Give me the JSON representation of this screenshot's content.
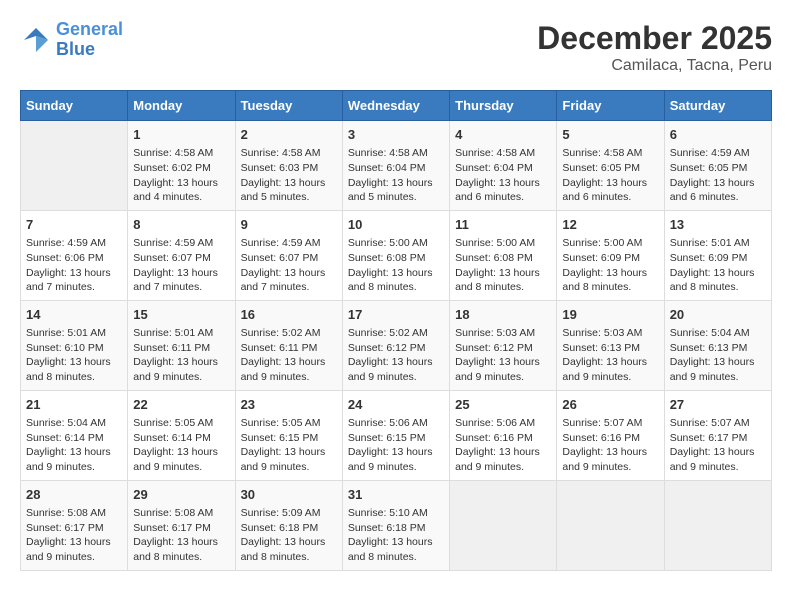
{
  "logo": {
    "line1": "General",
    "line2": "Blue"
  },
  "title": "December 2025",
  "subtitle": "Camilaca, Tacna, Peru",
  "days_header": [
    "Sunday",
    "Monday",
    "Tuesday",
    "Wednesday",
    "Thursday",
    "Friday",
    "Saturday"
  ],
  "weeks": [
    [
      {
        "day": "",
        "info": ""
      },
      {
        "day": "1",
        "info": "Sunrise: 4:58 AM\nSunset: 6:02 PM\nDaylight: 13 hours\nand 4 minutes."
      },
      {
        "day": "2",
        "info": "Sunrise: 4:58 AM\nSunset: 6:03 PM\nDaylight: 13 hours\nand 5 minutes."
      },
      {
        "day": "3",
        "info": "Sunrise: 4:58 AM\nSunset: 6:04 PM\nDaylight: 13 hours\nand 5 minutes."
      },
      {
        "day": "4",
        "info": "Sunrise: 4:58 AM\nSunset: 6:04 PM\nDaylight: 13 hours\nand 6 minutes."
      },
      {
        "day": "5",
        "info": "Sunrise: 4:58 AM\nSunset: 6:05 PM\nDaylight: 13 hours\nand 6 minutes."
      },
      {
        "day": "6",
        "info": "Sunrise: 4:59 AM\nSunset: 6:05 PM\nDaylight: 13 hours\nand 6 minutes."
      }
    ],
    [
      {
        "day": "7",
        "info": "Sunrise: 4:59 AM\nSunset: 6:06 PM\nDaylight: 13 hours\nand 7 minutes."
      },
      {
        "day": "8",
        "info": "Sunrise: 4:59 AM\nSunset: 6:07 PM\nDaylight: 13 hours\nand 7 minutes."
      },
      {
        "day": "9",
        "info": "Sunrise: 4:59 AM\nSunset: 6:07 PM\nDaylight: 13 hours\nand 7 minutes."
      },
      {
        "day": "10",
        "info": "Sunrise: 5:00 AM\nSunset: 6:08 PM\nDaylight: 13 hours\nand 8 minutes."
      },
      {
        "day": "11",
        "info": "Sunrise: 5:00 AM\nSunset: 6:08 PM\nDaylight: 13 hours\nand 8 minutes."
      },
      {
        "day": "12",
        "info": "Sunrise: 5:00 AM\nSunset: 6:09 PM\nDaylight: 13 hours\nand 8 minutes."
      },
      {
        "day": "13",
        "info": "Sunrise: 5:01 AM\nSunset: 6:09 PM\nDaylight: 13 hours\nand 8 minutes."
      }
    ],
    [
      {
        "day": "14",
        "info": "Sunrise: 5:01 AM\nSunset: 6:10 PM\nDaylight: 13 hours\nand 8 minutes."
      },
      {
        "day": "15",
        "info": "Sunrise: 5:01 AM\nSunset: 6:11 PM\nDaylight: 13 hours\nand 9 minutes."
      },
      {
        "day": "16",
        "info": "Sunrise: 5:02 AM\nSunset: 6:11 PM\nDaylight: 13 hours\nand 9 minutes."
      },
      {
        "day": "17",
        "info": "Sunrise: 5:02 AM\nSunset: 6:12 PM\nDaylight: 13 hours\nand 9 minutes."
      },
      {
        "day": "18",
        "info": "Sunrise: 5:03 AM\nSunset: 6:12 PM\nDaylight: 13 hours\nand 9 minutes."
      },
      {
        "day": "19",
        "info": "Sunrise: 5:03 AM\nSunset: 6:13 PM\nDaylight: 13 hours\nand 9 minutes."
      },
      {
        "day": "20",
        "info": "Sunrise: 5:04 AM\nSunset: 6:13 PM\nDaylight: 13 hours\nand 9 minutes."
      }
    ],
    [
      {
        "day": "21",
        "info": "Sunrise: 5:04 AM\nSunset: 6:14 PM\nDaylight: 13 hours\nand 9 minutes."
      },
      {
        "day": "22",
        "info": "Sunrise: 5:05 AM\nSunset: 6:14 PM\nDaylight: 13 hours\nand 9 minutes."
      },
      {
        "day": "23",
        "info": "Sunrise: 5:05 AM\nSunset: 6:15 PM\nDaylight: 13 hours\nand 9 minutes."
      },
      {
        "day": "24",
        "info": "Sunrise: 5:06 AM\nSunset: 6:15 PM\nDaylight: 13 hours\nand 9 minutes."
      },
      {
        "day": "25",
        "info": "Sunrise: 5:06 AM\nSunset: 6:16 PM\nDaylight: 13 hours\nand 9 minutes."
      },
      {
        "day": "26",
        "info": "Sunrise: 5:07 AM\nSunset: 6:16 PM\nDaylight: 13 hours\nand 9 minutes."
      },
      {
        "day": "27",
        "info": "Sunrise: 5:07 AM\nSunset: 6:17 PM\nDaylight: 13 hours\nand 9 minutes."
      }
    ],
    [
      {
        "day": "28",
        "info": "Sunrise: 5:08 AM\nSunset: 6:17 PM\nDaylight: 13 hours\nand 9 minutes."
      },
      {
        "day": "29",
        "info": "Sunrise: 5:08 AM\nSunset: 6:17 PM\nDaylight: 13 hours\nand 8 minutes."
      },
      {
        "day": "30",
        "info": "Sunrise: 5:09 AM\nSunset: 6:18 PM\nDaylight: 13 hours\nand 8 minutes."
      },
      {
        "day": "31",
        "info": "Sunrise: 5:10 AM\nSunset: 6:18 PM\nDaylight: 13 hours\nand 8 minutes."
      },
      {
        "day": "",
        "info": ""
      },
      {
        "day": "",
        "info": ""
      },
      {
        "day": "",
        "info": ""
      }
    ]
  ]
}
